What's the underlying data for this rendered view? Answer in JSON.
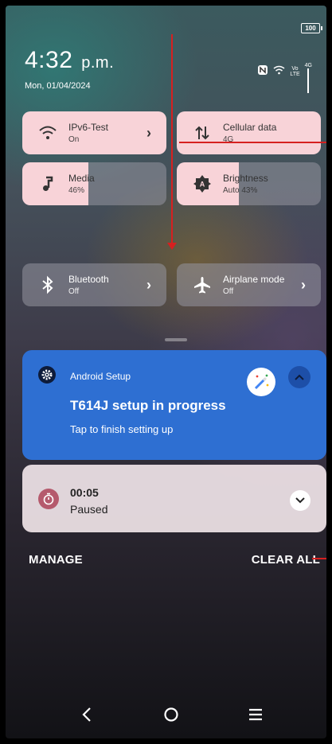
{
  "status": {
    "battery": "100",
    "time": "4:32",
    "ampm": "p.m.",
    "date": "Mon, 01/04/2024",
    "volte_label": "Vo",
    "lte_label": "LTE",
    "network_4g": "4G"
  },
  "tiles": [
    {
      "label": "IPv6-Test",
      "sub": "On",
      "icon": "wifi-icon",
      "state": "on"
    },
    {
      "label": "Cellular data",
      "sub": "4G",
      "icon": "cellular-data-icon",
      "state": "on"
    },
    {
      "label": "Media",
      "sub": "46%",
      "icon": "music-note-icon",
      "level": 0.46
    },
    {
      "label": "Brightness",
      "sub": "Auto 43%",
      "icon": "brightness-icon",
      "level": 0.43
    },
    {
      "label": "Bluetooth",
      "sub": "Off",
      "icon": "bluetooth-icon",
      "state": "off"
    },
    {
      "label": "Airplane mode",
      "sub": "Off",
      "icon": "airplane-icon",
      "state": "off"
    }
  ],
  "notifications": {
    "setup": {
      "app": "Android Setup",
      "title": "T614J setup in progress",
      "text": "Tap to finish setting up"
    },
    "timer": {
      "value": "00:05",
      "state": "Paused"
    }
  },
  "actions": {
    "manage": "MANAGE",
    "clear_all": "CLEAR ALL"
  },
  "colors": {
    "tile_on": "#f8d3d8",
    "notification_blue": "#2e6fd2",
    "annotation_red": "#d62020"
  }
}
